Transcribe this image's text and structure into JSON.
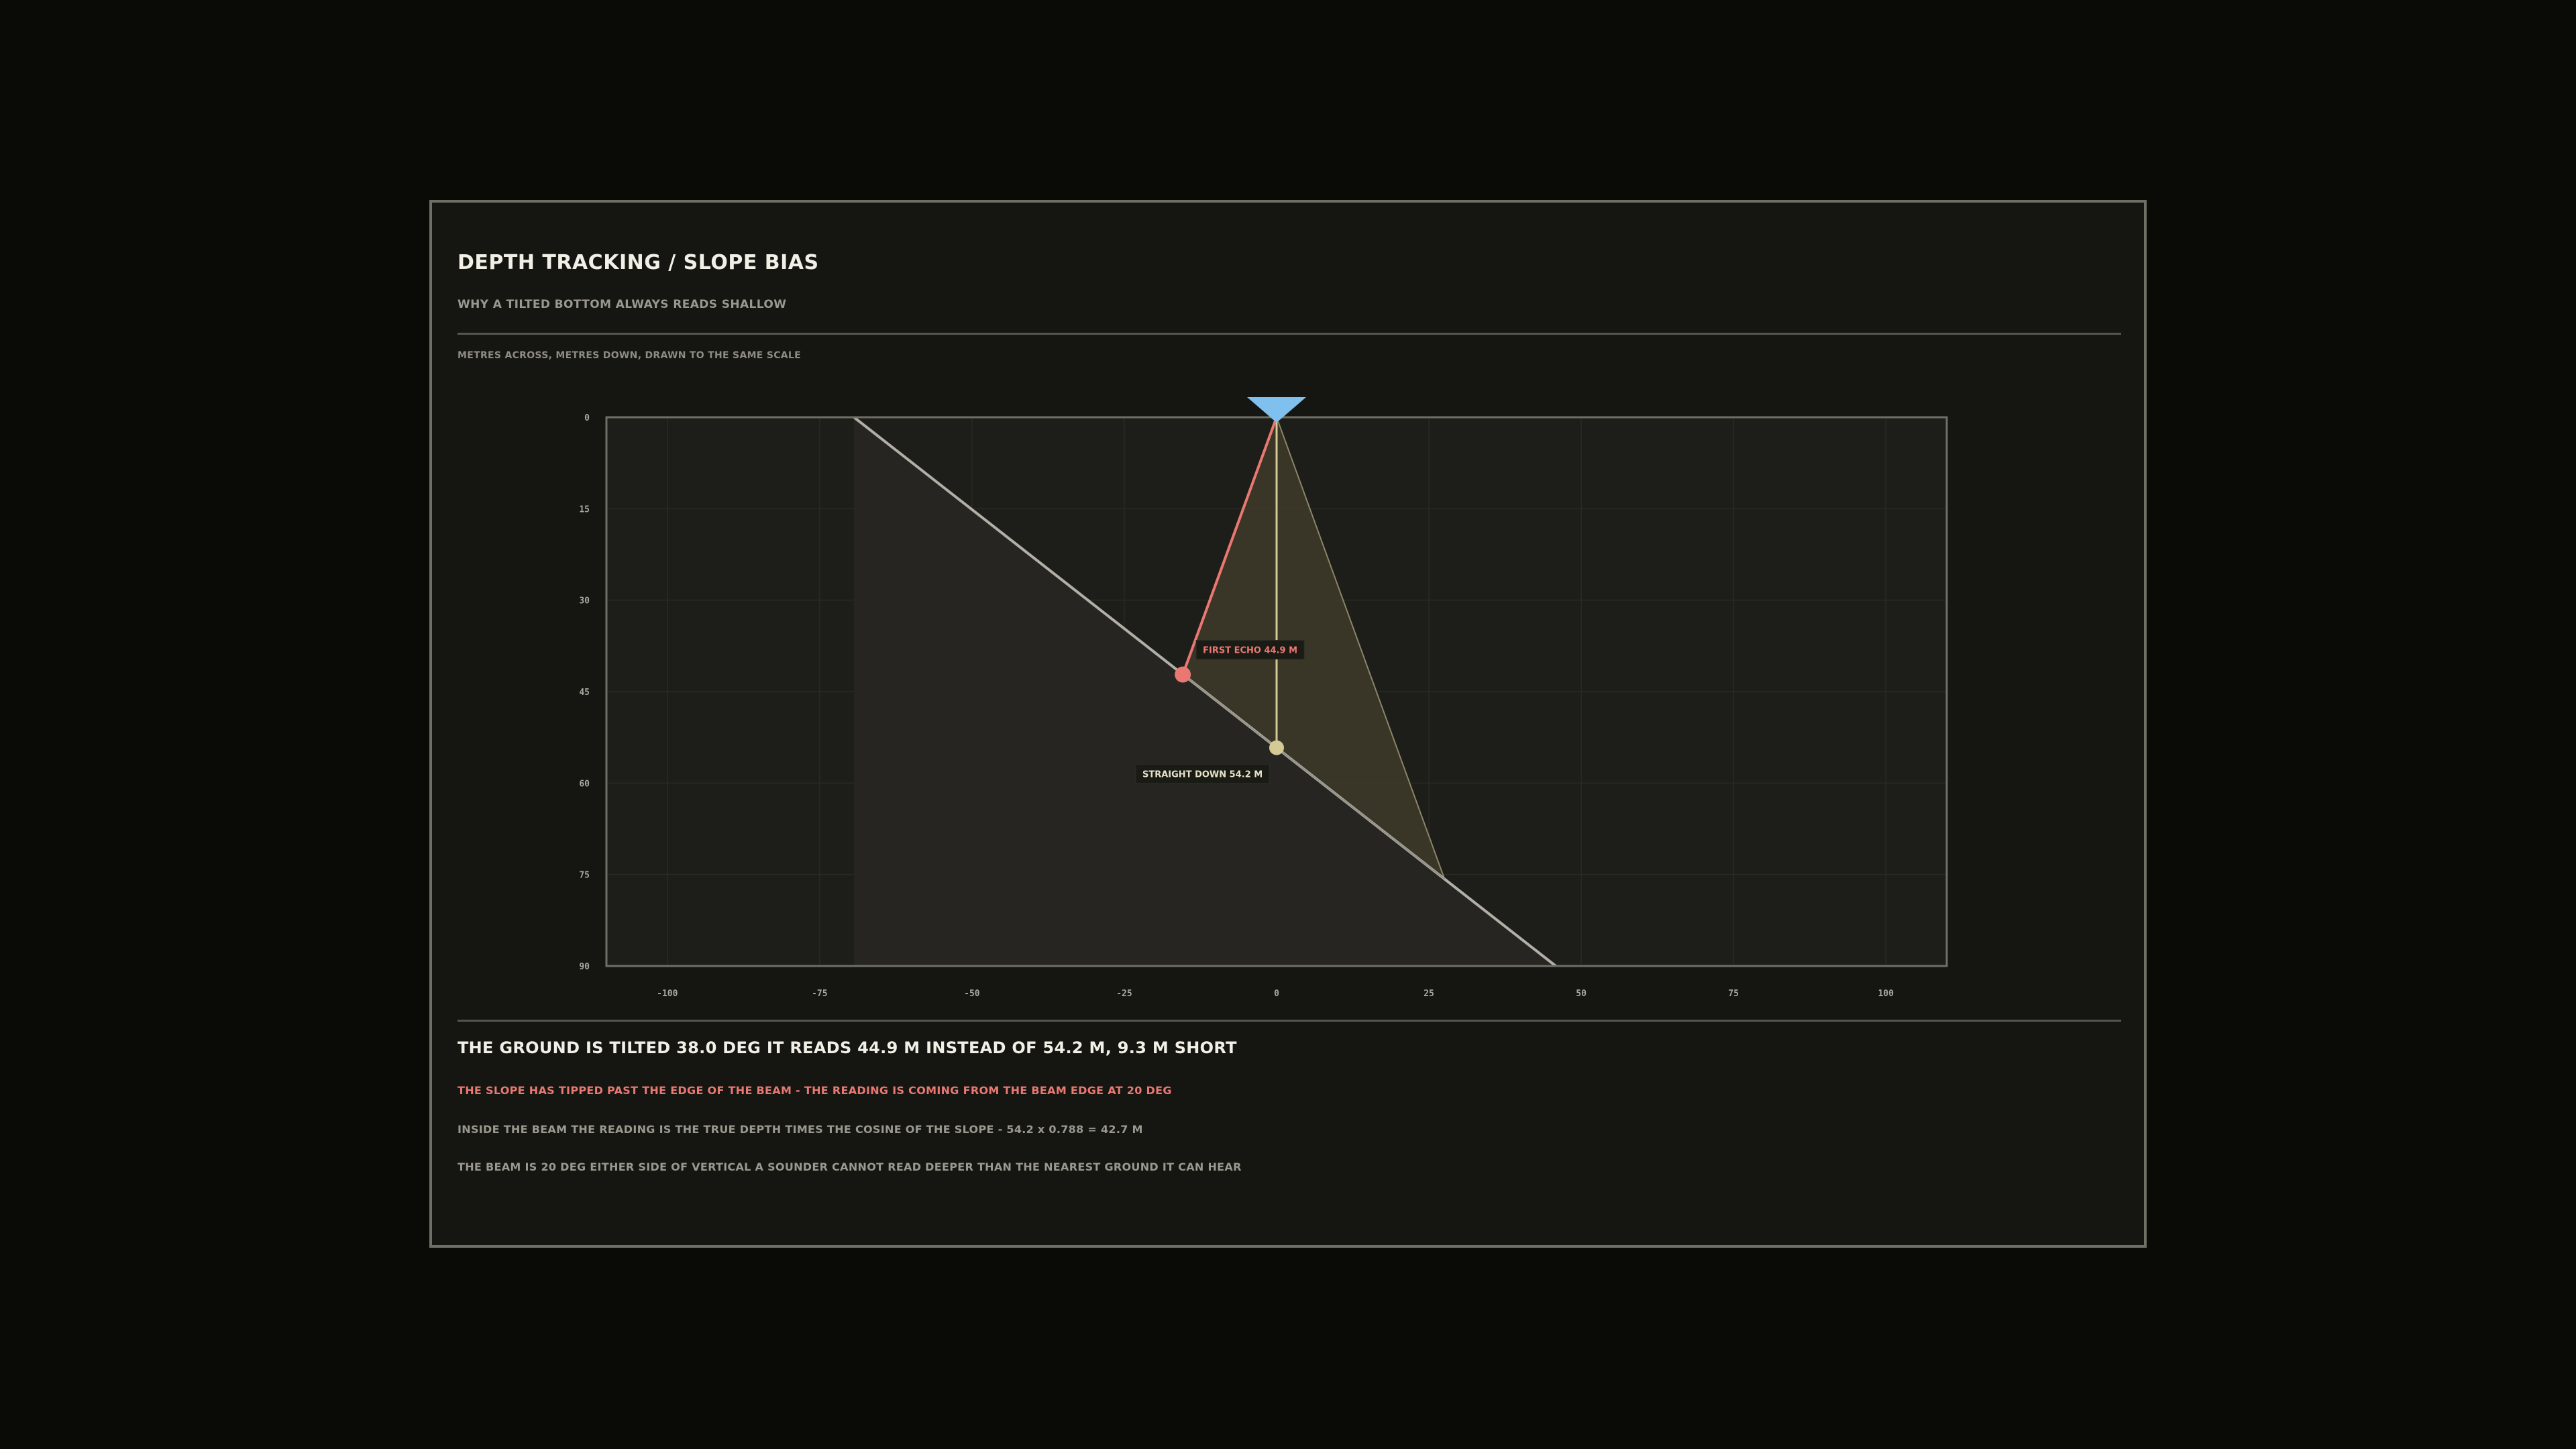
{
  "header": {
    "title": "DEPTH TRACKING / SLOPE BIAS",
    "subtitle": "WHY A TILTED BOTTOM ALWAYS READS SHALLOW"
  },
  "scale_note": "METRES ACROSS, METRES DOWN, DRAWN TO THE SAME SCALE",
  "chart_data": {
    "type": "diagram",
    "x_ticks": [
      "-100",
      "-75",
      "-50",
      "-25",
      "0",
      "25",
      "50",
      "75",
      "100"
    ],
    "y_ticks": [
      "0",
      "15",
      "30",
      "45",
      "60",
      "75",
      "90"
    ],
    "xlim": [
      -110,
      110
    ],
    "ylim": [
      0,
      90
    ],
    "slope_deg": 38.0,
    "beam_half_angle_deg": 20,
    "true_depth_m": 54.2,
    "echo_depth_m": 44.9,
    "echo_point": {
      "x": -15.4,
      "y": 42.2
    },
    "straight_point": {
      "x": 0,
      "y": 54.2
    },
    "seabed_fill_start_x": -69.4,
    "labels": {
      "first_echo": "FIRST ECHO  44.9 M",
      "straight_down": "STRAIGHT DOWN  54.2 M"
    },
    "colors": {
      "echo": "#ea7872",
      "straight": "#d4ca96",
      "transducer": "#7fc0ef",
      "seabed": "#b2b0a6",
      "beam_fill": "#3e3a2a"
    }
  },
  "summary": {
    "headline": "THE GROUND IS TILTED  38.0 DEG   IT READS  44.9 M INSTEAD OF  54.2 M,  9.3 M SHORT",
    "warning": "THE SLOPE HAS TIPPED PAST THE EDGE OF THE BEAM - THE READING IS COMING FROM THE BEAM EDGE AT 20 DEG",
    "note1": "INSIDE THE BEAM THE READING IS THE TRUE DEPTH TIMES THE COSINE OF THE SLOPE -  54.2 x 0.788 =  42.7 M",
    "note2": "THE BEAM IS 20 DEG EITHER SIDE OF VERTICAL   A SOUNDER CANNOT READ DEEPER THAN THE NEAREST GROUND IT CAN HEAR"
  }
}
